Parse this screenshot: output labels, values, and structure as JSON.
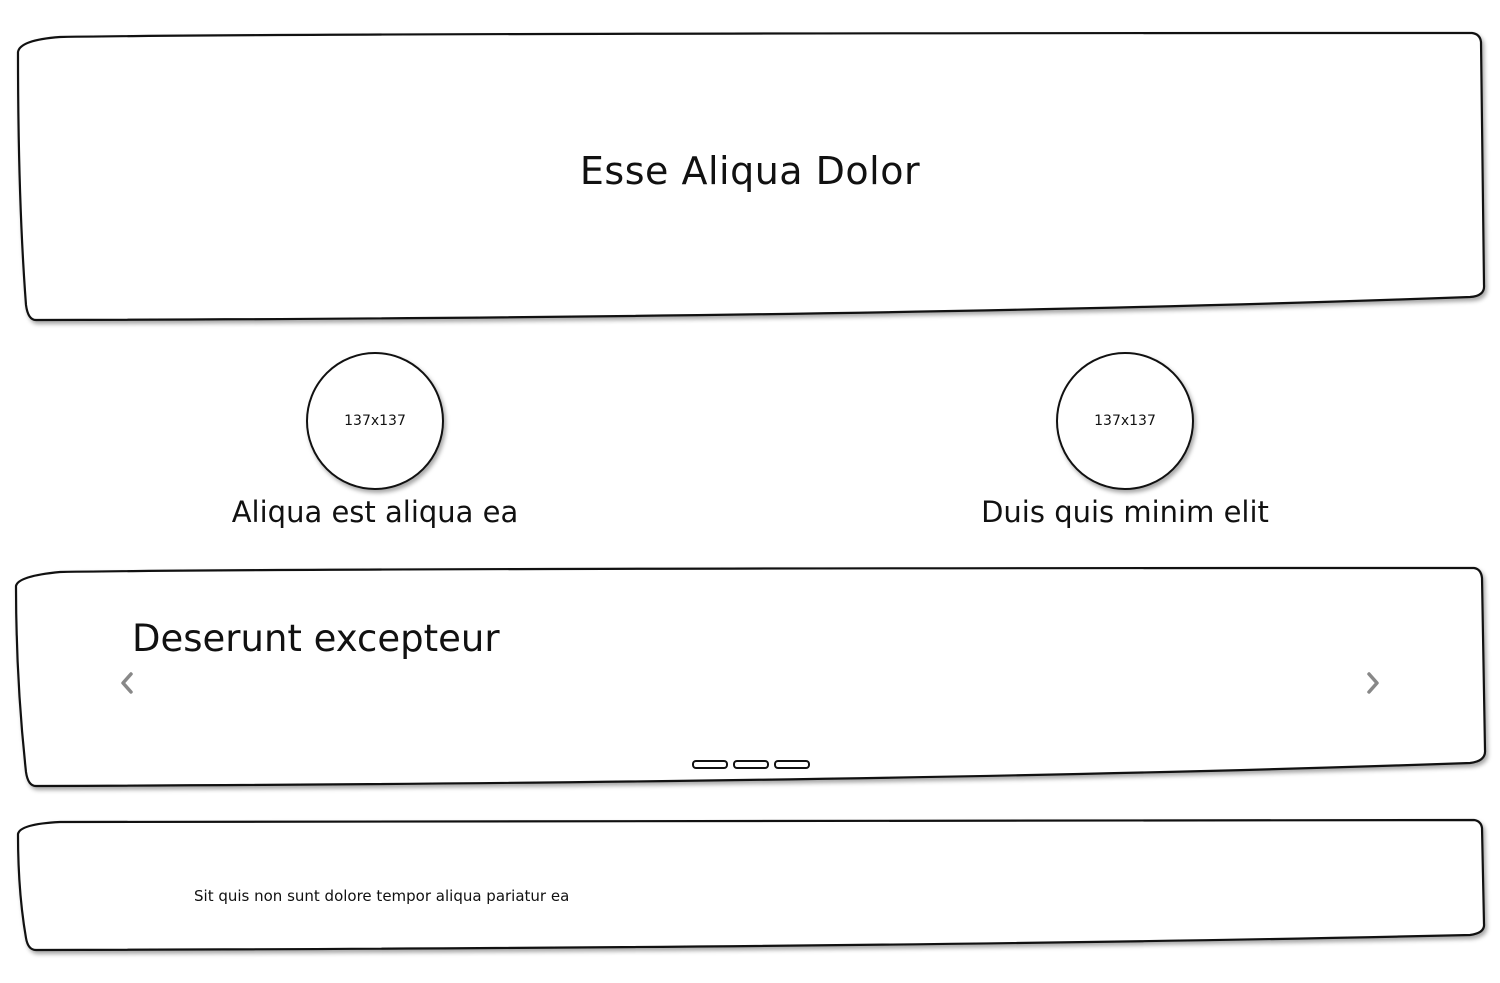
{
  "hero": {
    "title": "Esse Aliqua Dolor"
  },
  "features": [
    {
      "image_placeholder": "137x137",
      "caption": "Aliqua est aliqua ea"
    },
    {
      "image_placeholder": "137x137",
      "caption": "Duis quis minim elit"
    }
  ],
  "carousel": {
    "heading": "Deserunt excepteur",
    "prev_icon": "chevron-left-icon",
    "next_icon": "chevron-right-icon",
    "slide_count": 3,
    "arrow_color": "#888888"
  },
  "footer": {
    "text": "Sit quis non sunt dolore tempor aliqua pariatur ea"
  }
}
